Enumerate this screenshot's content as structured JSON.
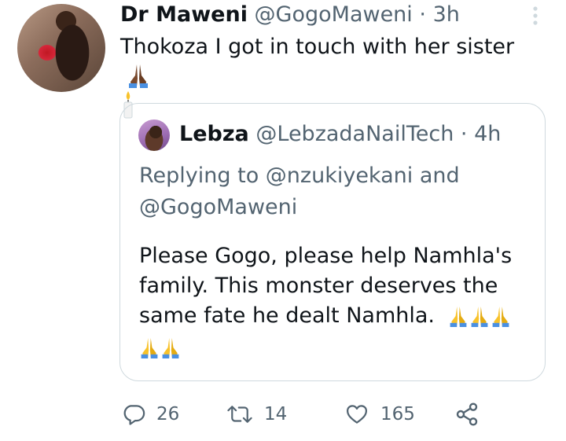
{
  "tweet": {
    "author_name": "Dr Maweni",
    "author_handle": "@GogoMaweni",
    "separator": "·",
    "time": "3h",
    "text": "Thokoza I got in touch with her sister",
    "emojis": [
      "folded-hands-dark-icon",
      "candle-icon"
    ]
  },
  "quote": {
    "author_name": "Lebza",
    "author_handle": "@LebzadaNailTech",
    "separator": "·",
    "time": "4h",
    "replying_line1": "Replying to @nzukiyekani and",
    "replying_line2": "@GogoMaweni",
    "body_line1": "Please Gogo, please help Namhla's",
    "body_line2": "family. This monster deserves the",
    "body_line3": "same fate he dealt Namhla.",
    "emoji_count": 5
  },
  "actions": {
    "reply_count": "26",
    "retweet_count": "14",
    "like_count": "165",
    "icons": [
      "reply-icon",
      "retweet-icon",
      "like-icon",
      "share-icon"
    ]
  },
  "colors": {
    "text_primary": "#0f1419",
    "text_secondary": "#536471",
    "border": "#cfd9de",
    "emoji_yellow": "#f8c22a",
    "emoji_blue": "#4a90e2",
    "emoji_dark_skin": "#7a4a2e"
  }
}
